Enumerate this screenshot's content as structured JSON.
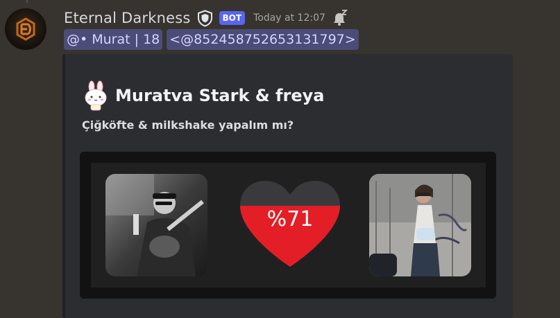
{
  "message": {
    "author": "Eternal Darkness",
    "bot_badge": "BOT",
    "timestamp": "Today at 12:07",
    "mentions": [
      "@• Murat | 18",
      "<@852458752653131797>"
    ]
  },
  "embed": {
    "title": "Muratva Stark & freya",
    "description": "Çiğköfte & milkshake yapalım mı?",
    "love_percent_label": "%71",
    "love_fraction": 0.71
  },
  "colors": {
    "bot_badge": "#5865f2",
    "mention_bg": "#4b4c77",
    "heart_fill": "#e41e26",
    "heart_empty": "#3a3a3c",
    "embed_bg": "#2b2d31"
  },
  "icons": {
    "shield": "shield-icon",
    "bell": "bell-sleep-icon",
    "bunny": "bunny-emoji-icon"
  }
}
